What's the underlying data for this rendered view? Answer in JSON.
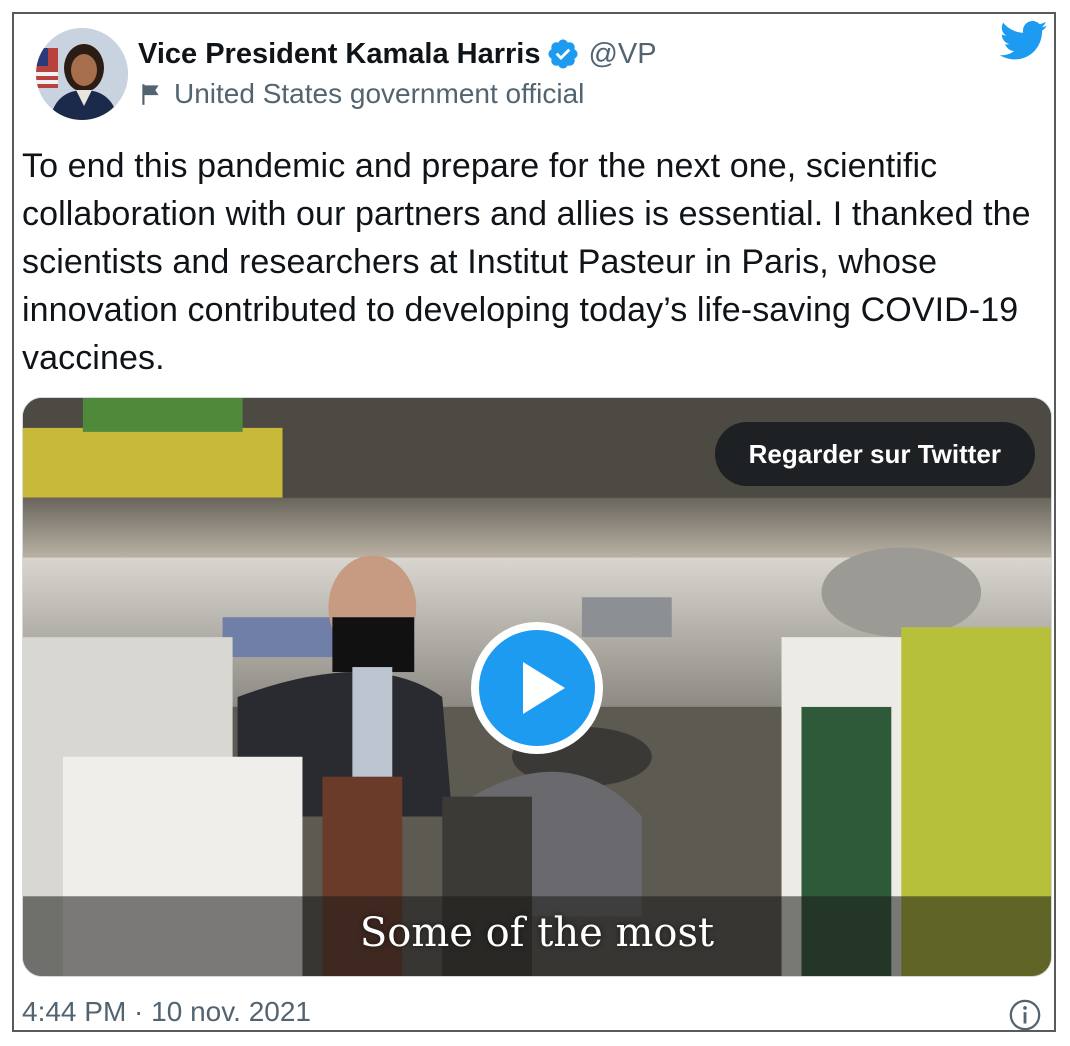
{
  "author": {
    "display_name": "Vice President Kamala Harris",
    "handle": "@VP",
    "affiliation": "United States government official"
  },
  "icons": {
    "verified": "verified-badge-icon",
    "affiliation": "flag-icon",
    "brand": "twitter-bird-icon",
    "play": "play-icon",
    "info": "info-icon"
  },
  "colors": {
    "brand_blue": "#1d9bf0",
    "text_primary": "#0f1419",
    "text_secondary": "#536471"
  },
  "tweet": {
    "text": "To end this pandemic and prepare for the next one, scientific collaboration with our partners and allies is essential. I thanked the scientists and researchers at Institut Pasteur in Paris, whose innovation contributed to developing today’s life-saving COVID-19 vaccines."
  },
  "media": {
    "watch_label": "Regarder sur Twitter",
    "caption": "Some of the most"
  },
  "footer": {
    "timestamp": "4:44 PM · 10 nov. 2021"
  }
}
